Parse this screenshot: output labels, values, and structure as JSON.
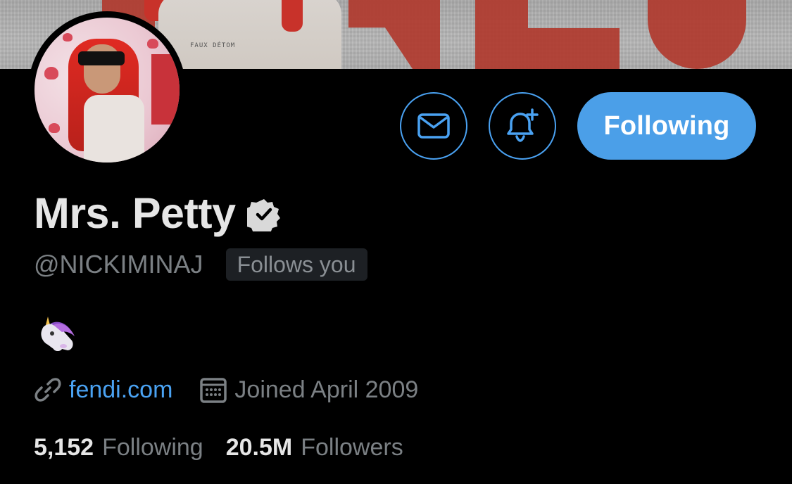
{
  "header": {
    "banner_sketch_text": "FAUX DÉTOM"
  },
  "actions": {
    "message_icon": "envelope-icon",
    "notify_icon": "bell-plus-icon",
    "follow_label": "Following"
  },
  "profile": {
    "display_name": "Mrs. Petty",
    "verified_icon": "verified-badge-icon",
    "handle": "@NICKIMINAJ",
    "follows_you": "Follows you",
    "bio_emoji": "unicorn-emoji",
    "website": "fendi.com",
    "website_icon": "link-icon",
    "joined": "Joined April 2009",
    "joined_icon": "calendar-icon"
  },
  "stats": {
    "following_count": "5,152",
    "following_label": "Following",
    "followers_count": "20.5M",
    "followers_label": "Followers"
  },
  "colors": {
    "accent": "#4aa2f2",
    "button_fill": "#4b9fe8",
    "background": "#000000",
    "secondary_text": "#7b8084"
  }
}
